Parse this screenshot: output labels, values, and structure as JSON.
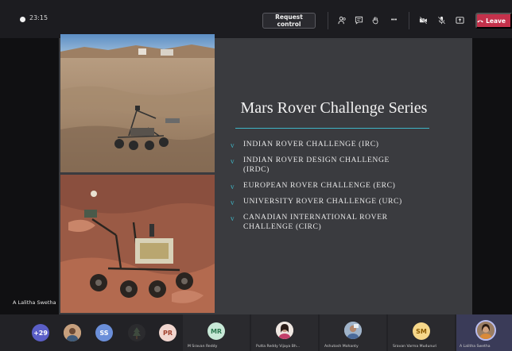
{
  "meeting": {
    "timer": "23:15",
    "request_control": "Request control",
    "more": "•••",
    "leave": "Leave"
  },
  "colors": {
    "leave": "#c4314b",
    "accent": "#3fb6c7",
    "slide_bg": "#3a3b3f"
  },
  "slide": {
    "title": "Mars Rover Challenge Series",
    "bullet_glyph": "v",
    "bullets": [
      [
        "INDIAN ROVER CHALLENGE (IRC)"
      ],
      [
        "INDIAN ROVER DESIGN CHALLENGE",
        "(IRDC)"
      ],
      [
        "EUROPEAN ROVER CHALLENGE (ERC)"
      ],
      [
        "UNIVERSITY ROVER CHALLENGE (URC)"
      ],
      [
        "CANADIAN INTERNATIONAL ROVER",
        "CHALLENGE (CIRC)"
      ]
    ]
  },
  "presenter": "A Lalitha Swetha",
  "participants": {
    "overflow": "+29",
    "ss": "SS",
    "pr": "PR",
    "mr": "MR",
    "sm": "SM",
    "names": [
      "M Sravan Reddy",
      "Putta Reddy Vijaya Bh...",
      "Ashutosh Mohanty",
      "Sravan Varma Mudunuri",
      "A Lalitha Swetha"
    ]
  },
  "icons": [
    "record-dot-icon",
    "people-icon",
    "chat-icon",
    "raise-hand-icon",
    "more-icon",
    "camera-off-icon",
    "mic-off-icon",
    "share-icon",
    "phone-icon"
  ]
}
